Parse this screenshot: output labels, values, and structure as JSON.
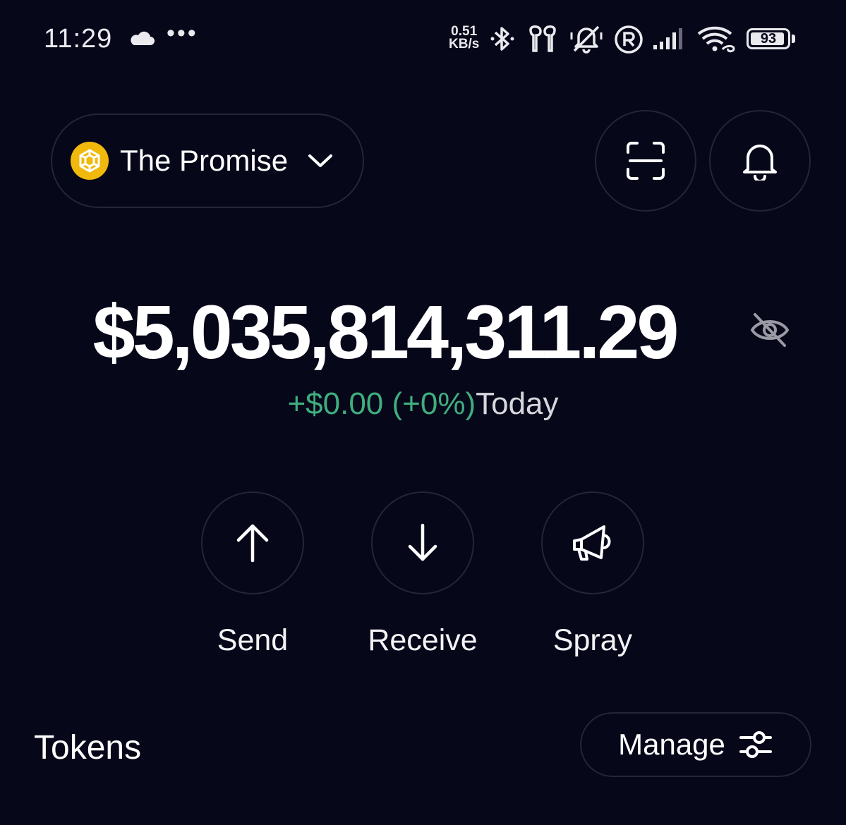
{
  "status_bar": {
    "time": "11:29",
    "dots": "•••",
    "net_speed_value": "0.51",
    "net_speed_unit": "KB/s",
    "battery": "93",
    "battery_fraction": 0.93,
    "icons": [
      "cloud-icon",
      "bluetooth-icon",
      "earbuds-icon",
      "mute-icon",
      "registered-icon",
      "signal-icon",
      "wifi-icon",
      "battery-icon"
    ]
  },
  "header": {
    "wallet_name": "The Promise",
    "wallet_icon": "bnb-coin-icon",
    "scan_icon": "scan-icon",
    "bell_icon": "bell-icon",
    "coin_color": "#f0b90b"
  },
  "balance": {
    "amount": "$5,035,814,311.29",
    "change": "+$0.00 (+0%)",
    "period": "Today",
    "change_color": "#3fae7e"
  },
  "actions": [
    {
      "label": "Send",
      "icon": "arrow-up-icon"
    },
    {
      "label": "Receive",
      "icon": "arrow-down-icon"
    },
    {
      "label": "Spray",
      "icon": "megaphone-icon"
    }
  ],
  "tokens": {
    "title": "Tokens",
    "manage_label": "Manage",
    "manage_icon": "sliders-icon"
  },
  "colors": {
    "background": "#07071a",
    "border": "#25253a"
  }
}
